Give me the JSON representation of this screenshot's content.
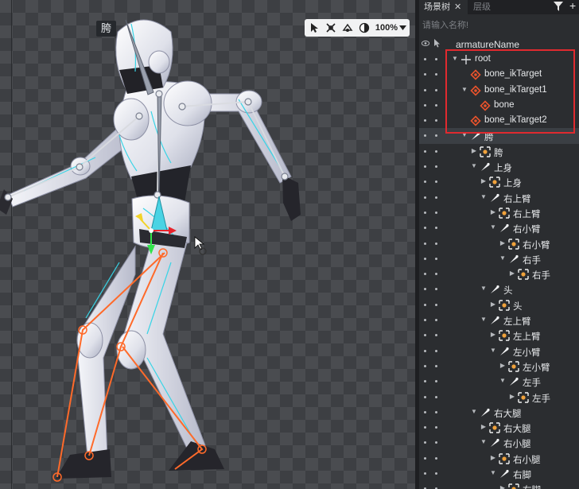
{
  "viewport": {
    "selected_bone_tag": "胯",
    "zoom": "100%"
  },
  "panel": {
    "tabs": [
      {
        "label": "场景树"
      },
      {
        "label": "层级"
      }
    ],
    "search_placeholder": "请输入名称!",
    "armature_name": "armatureName"
  },
  "highlight_color": "#e02a2f",
  "tree": [
    {
      "label": "root",
      "depth": 0,
      "arrow": "down",
      "icon": "cross"
    },
    {
      "label": "bone_ikTarget",
      "depth": 1,
      "arrow": "",
      "icon": "ik"
    },
    {
      "label": "bone_ikTarget1",
      "depth": 1,
      "arrow": "down",
      "icon": "ik"
    },
    {
      "label": "bone",
      "depth": 2,
      "arrow": "",
      "icon": "ik"
    },
    {
      "label": "bone_ikTarget2",
      "depth": 1,
      "arrow": "",
      "icon": "ik"
    },
    {
      "label": "胯",
      "depth": 1,
      "arrow": "down",
      "icon": "bone",
      "selected": true
    },
    {
      "label": "胯",
      "depth": 2,
      "arrow": "right",
      "icon": "slot"
    },
    {
      "label": "上身",
      "depth": 2,
      "arrow": "down",
      "icon": "bone"
    },
    {
      "label": "上身",
      "depth": 3,
      "arrow": "right",
      "icon": "slot"
    },
    {
      "label": "右上臂",
      "depth": 3,
      "arrow": "down",
      "icon": "bone"
    },
    {
      "label": "右上臂",
      "depth": 4,
      "arrow": "right",
      "icon": "slot"
    },
    {
      "label": "右小臂",
      "depth": 4,
      "arrow": "down",
      "icon": "bone"
    },
    {
      "label": "右小臂",
      "depth": 5,
      "arrow": "right",
      "icon": "slot"
    },
    {
      "label": "右手",
      "depth": 5,
      "arrow": "down",
      "icon": "bone"
    },
    {
      "label": "右手",
      "depth": 6,
      "arrow": "right",
      "icon": "slot"
    },
    {
      "label": "头",
      "depth": 3,
      "arrow": "down",
      "icon": "bone"
    },
    {
      "label": "头",
      "depth": 4,
      "arrow": "right",
      "icon": "slot"
    },
    {
      "label": "左上臂",
      "depth": 3,
      "arrow": "down",
      "icon": "bone"
    },
    {
      "label": "左上臂",
      "depth": 4,
      "arrow": "right",
      "icon": "slot"
    },
    {
      "label": "左小臂",
      "depth": 4,
      "arrow": "down",
      "icon": "bone"
    },
    {
      "label": "左小臂",
      "depth": 5,
      "arrow": "right",
      "icon": "slot"
    },
    {
      "label": "左手",
      "depth": 5,
      "arrow": "down",
      "icon": "bone"
    },
    {
      "label": "左手",
      "depth": 6,
      "arrow": "right",
      "icon": "slot"
    },
    {
      "label": "右大腿",
      "depth": 2,
      "arrow": "down",
      "icon": "bone"
    },
    {
      "label": "右大腿",
      "depth": 3,
      "arrow": "right",
      "icon": "slot"
    },
    {
      "label": "右小腿",
      "depth": 3,
      "arrow": "down",
      "icon": "bone"
    },
    {
      "label": "右小腿",
      "depth": 4,
      "arrow": "right",
      "icon": "slot"
    },
    {
      "label": "右脚",
      "depth": 4,
      "arrow": "down",
      "icon": "bone"
    },
    {
      "label": "右脚",
      "depth": 5,
      "arrow": "right",
      "icon": "slot"
    }
  ]
}
